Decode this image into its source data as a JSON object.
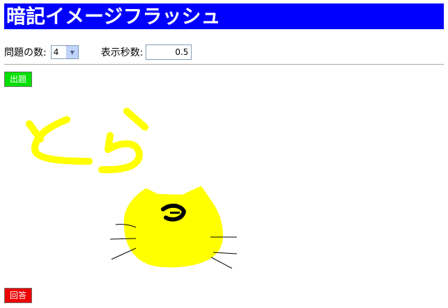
{
  "header": {
    "title": "暗記イメージフラッシュ"
  },
  "controls": {
    "count_label": "問題の数:",
    "count_value": "4",
    "seconds_label": "表示秒数:",
    "seconds_value": "0.5"
  },
  "buttons": {
    "start_label": "出題",
    "answer_label": "回答"
  },
  "drawing": {
    "handwritten_text": "とら",
    "subject": "cat",
    "colors": {
      "fill": "#ffff00",
      "outline": "#000000"
    }
  },
  "colors": {
    "title_bg": "#0000ff",
    "title_text": "#ffffff",
    "start_button": "#00e000",
    "answer_button": "#ee0000"
  }
}
